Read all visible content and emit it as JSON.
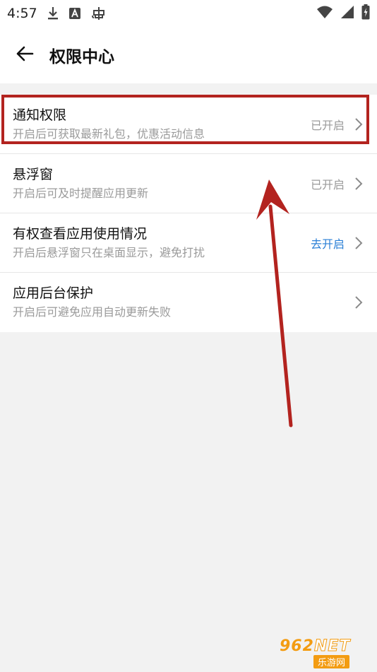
{
  "status_bar": {
    "time": "4:57",
    "icons": [
      "download-icon",
      "a-badge-icon",
      "bug-icon"
    ],
    "right_icons": [
      "wifi-icon",
      "signal-icon",
      "battery-charging-icon"
    ]
  },
  "header": {
    "title": "权限中心",
    "back_icon": "arrow-left-icon"
  },
  "permissions": [
    {
      "title": "通知权限",
      "desc": "开启后可获取最新礼包，优惠活动信息",
      "status": "已开启",
      "status_active": false
    },
    {
      "title": "悬浮窗",
      "desc": "开启后可及时提醒应用更新",
      "status": "已开启",
      "status_active": false
    },
    {
      "title": "有权查看应用使用情况",
      "desc": "开启后悬浮窗只在桌面显示，避免打扰",
      "status": "去开启",
      "status_active": true
    },
    {
      "title": "应用后台保护",
      "desc": "开启后可避免应用自动更新失败",
      "status": "",
      "status_active": false
    }
  ],
  "watermark": {
    "number": "962",
    "suffix": "NET",
    "caption": "乐游网"
  },
  "colors": {
    "accent": "#2a7fd6",
    "annotation": "#b3231f",
    "muted": "#9a9a9a",
    "watermark": "#f39c12"
  }
}
